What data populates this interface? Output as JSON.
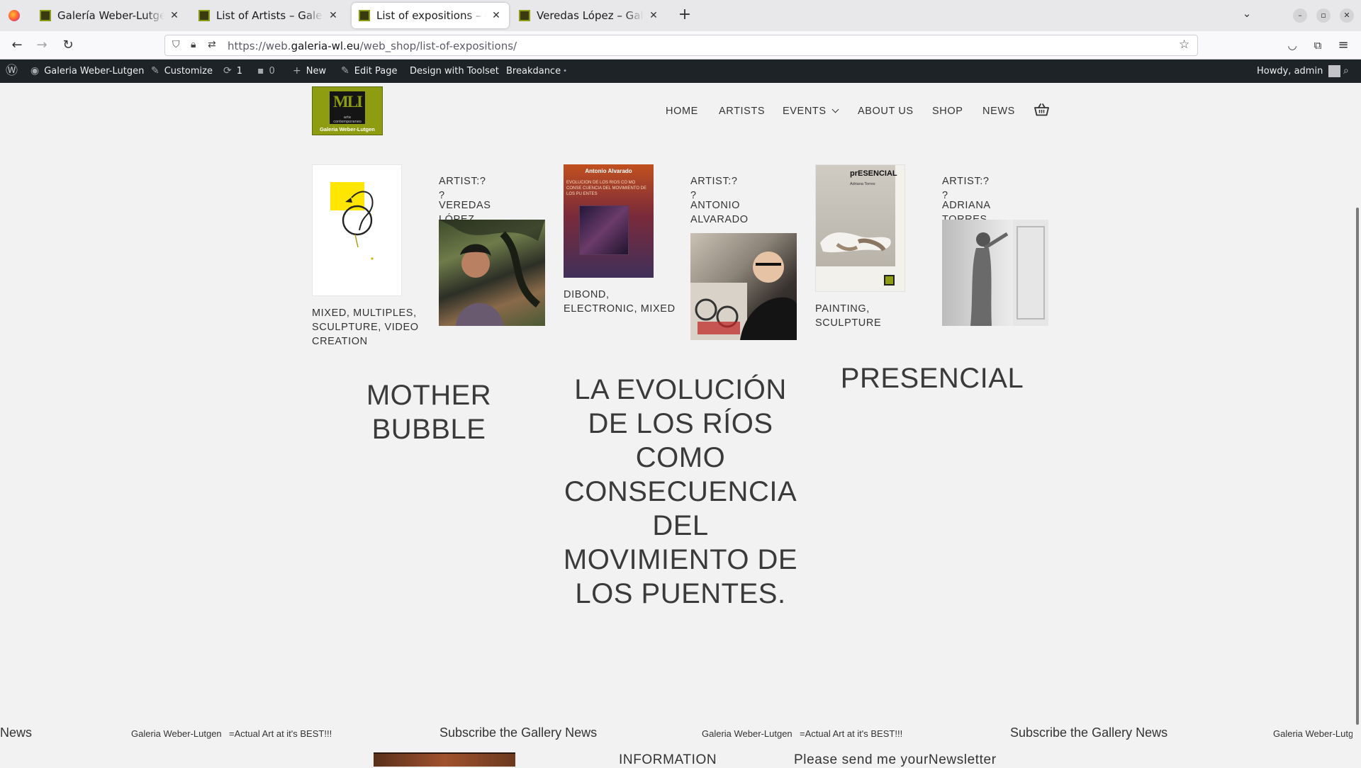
{
  "browser": {
    "tabs": [
      {
        "title": "Galería Weber-Lutgen",
        "active": false
      },
      {
        "title": "List of Artists – Galería Weber-Lutgen",
        "active": false
      },
      {
        "title": "List of expositions – Galería Weber-Lutgen",
        "active": true
      },
      {
        "title": "Veredas López – Galería Weber-Lutgen",
        "active": false
      }
    ],
    "url_prefix": "https://web.",
    "url_domain": "galeria-wl.eu",
    "url_path": "/web_shop/list-of-expositions/"
  },
  "wp_admin_bar": {
    "site_name": "Galeria Weber-Lutgen",
    "customize": "Customize",
    "updates_count": "1",
    "comments_count": "0",
    "new": "New",
    "edit_page": "Edit Page",
    "toolset": "Design with Toolset",
    "breakdance": "Breakdance",
    "breakdance_dot": "•",
    "howdy": "Howdy, admin"
  },
  "site": {
    "logo_mark": "MLI",
    "logo_sub": "arte contemporaneo",
    "logo_name": "Galeria Weber-Lutgen",
    "menu": [
      "HOME",
      "ARTISTS",
      "EVENTS",
      "ABOUT US",
      "SHOP",
      "NEWS"
    ]
  },
  "expositions": [
    {
      "artist_label": "ARTIST:? ?",
      "artist_name": "VEREDAS LÓPEZ",
      "techniques": "MIXED, MULTIPLES, SCULPTURE, VIDEO CREATION",
      "title": "MOTHER BUBBLE"
    },
    {
      "artist_label": "ARTIST:? ?",
      "artist_name": "ANTONIO ALVARADO",
      "techniques": "DIBOND, ELECTRONIC, MIXED",
      "title": "LA EVOLUCIÓN DE LOS RÍOS COMO CONSECUENCIA DEL MOVIMIENTO DE LOS PUENTES.",
      "poster_author": "Antonio Alvarado",
      "poster_title": "EVOLUCION DE LOS RIOS CO MO CONSE CUENCIA DEL MOVIMIENTO DE LOS PU ENTES"
    },
    {
      "artist_label": "ARTIST:? ?",
      "artist_name": "ADRIANA TORRES",
      "techniques": "PAINTING, SCULPTURE",
      "title": "PRESENCIAL",
      "poster_title": "prESENCIAL",
      "poster_author": "Adriana Torres"
    }
  ],
  "ticker": {
    "news": "News",
    "tagline_name": "Galeria Weber-Lutgen",
    "tagline": "=Actual Art at it's BEST!!!",
    "subscribe": "Subscribe the Gallery News"
  },
  "footer": {
    "information": "INFORMATION",
    "newsletter": "Please send me yourNewsletter"
  },
  "colors": {
    "brand": "#8d9c10",
    "admin_bar": "#1d2327",
    "page_bg": "#f2f2f2"
  }
}
